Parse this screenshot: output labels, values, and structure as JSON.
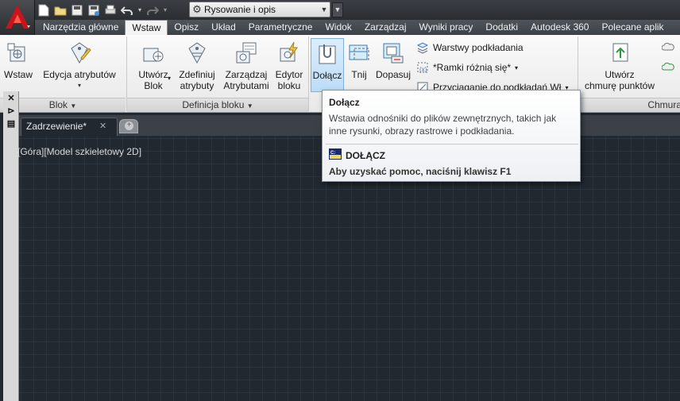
{
  "quick_access": {
    "workspace": "Rysowanie i opis"
  },
  "ribbon_tabs": [
    {
      "label": "Narzędzia główne"
    },
    {
      "label": "Wstaw"
    },
    {
      "label": "Opisz"
    },
    {
      "label": "Układ"
    },
    {
      "label": "Parametryczne"
    },
    {
      "label": "Widok"
    },
    {
      "label": "Zarządzaj"
    },
    {
      "label": "Wyniki pracy"
    },
    {
      "label": "Dodatki"
    },
    {
      "label": "Autodesk 360"
    },
    {
      "label": "Polecane aplik"
    }
  ],
  "ribbon": {
    "wstaw": "Wstaw",
    "edycja_atrybutow": "Edycja atrybutów",
    "utworz_blok_1": "Utwórz",
    "utworz_blok_2": "Blok",
    "zdefiniuj_1": "Zdefiniuj",
    "zdefiniuj_2": "atrybuty",
    "zarzadzaj_1": "Zarządzaj",
    "zarzadzaj_2": "Atrybutami",
    "edytor_1": "Edytor",
    "edytor_2": "bloku",
    "dolacz": "Dołącz",
    "tnij": "Tnij",
    "dopasuj": "Dopasuj",
    "warstwy": "Warstwy podkładania",
    "ramki": "*Ramki różnią się*",
    "przyciaganie": "Przyciąganie do podkładań Wł",
    "utworz_chmure_1": "Utwórz",
    "utworz_chmure_2": "chmurę punktów",
    "panel_blok": "Blok",
    "panel_definicja": "Definicja bloku",
    "panel_chmura": "Chmura"
  },
  "document": {
    "tab_label": "Zadrzewienie*",
    "view_label": "[Góra][Model szkieletowy 2D]"
  },
  "tooltip": {
    "title": "Dołącz",
    "description": "Wstawia odnośniki do plików zewnętrznych, takich jak inne rysunki, obrazy rastrowe i podkładania.",
    "command": "DOŁĄCZ",
    "help": "Aby uzyskać pomoc, naciśnij klawisz F1"
  }
}
